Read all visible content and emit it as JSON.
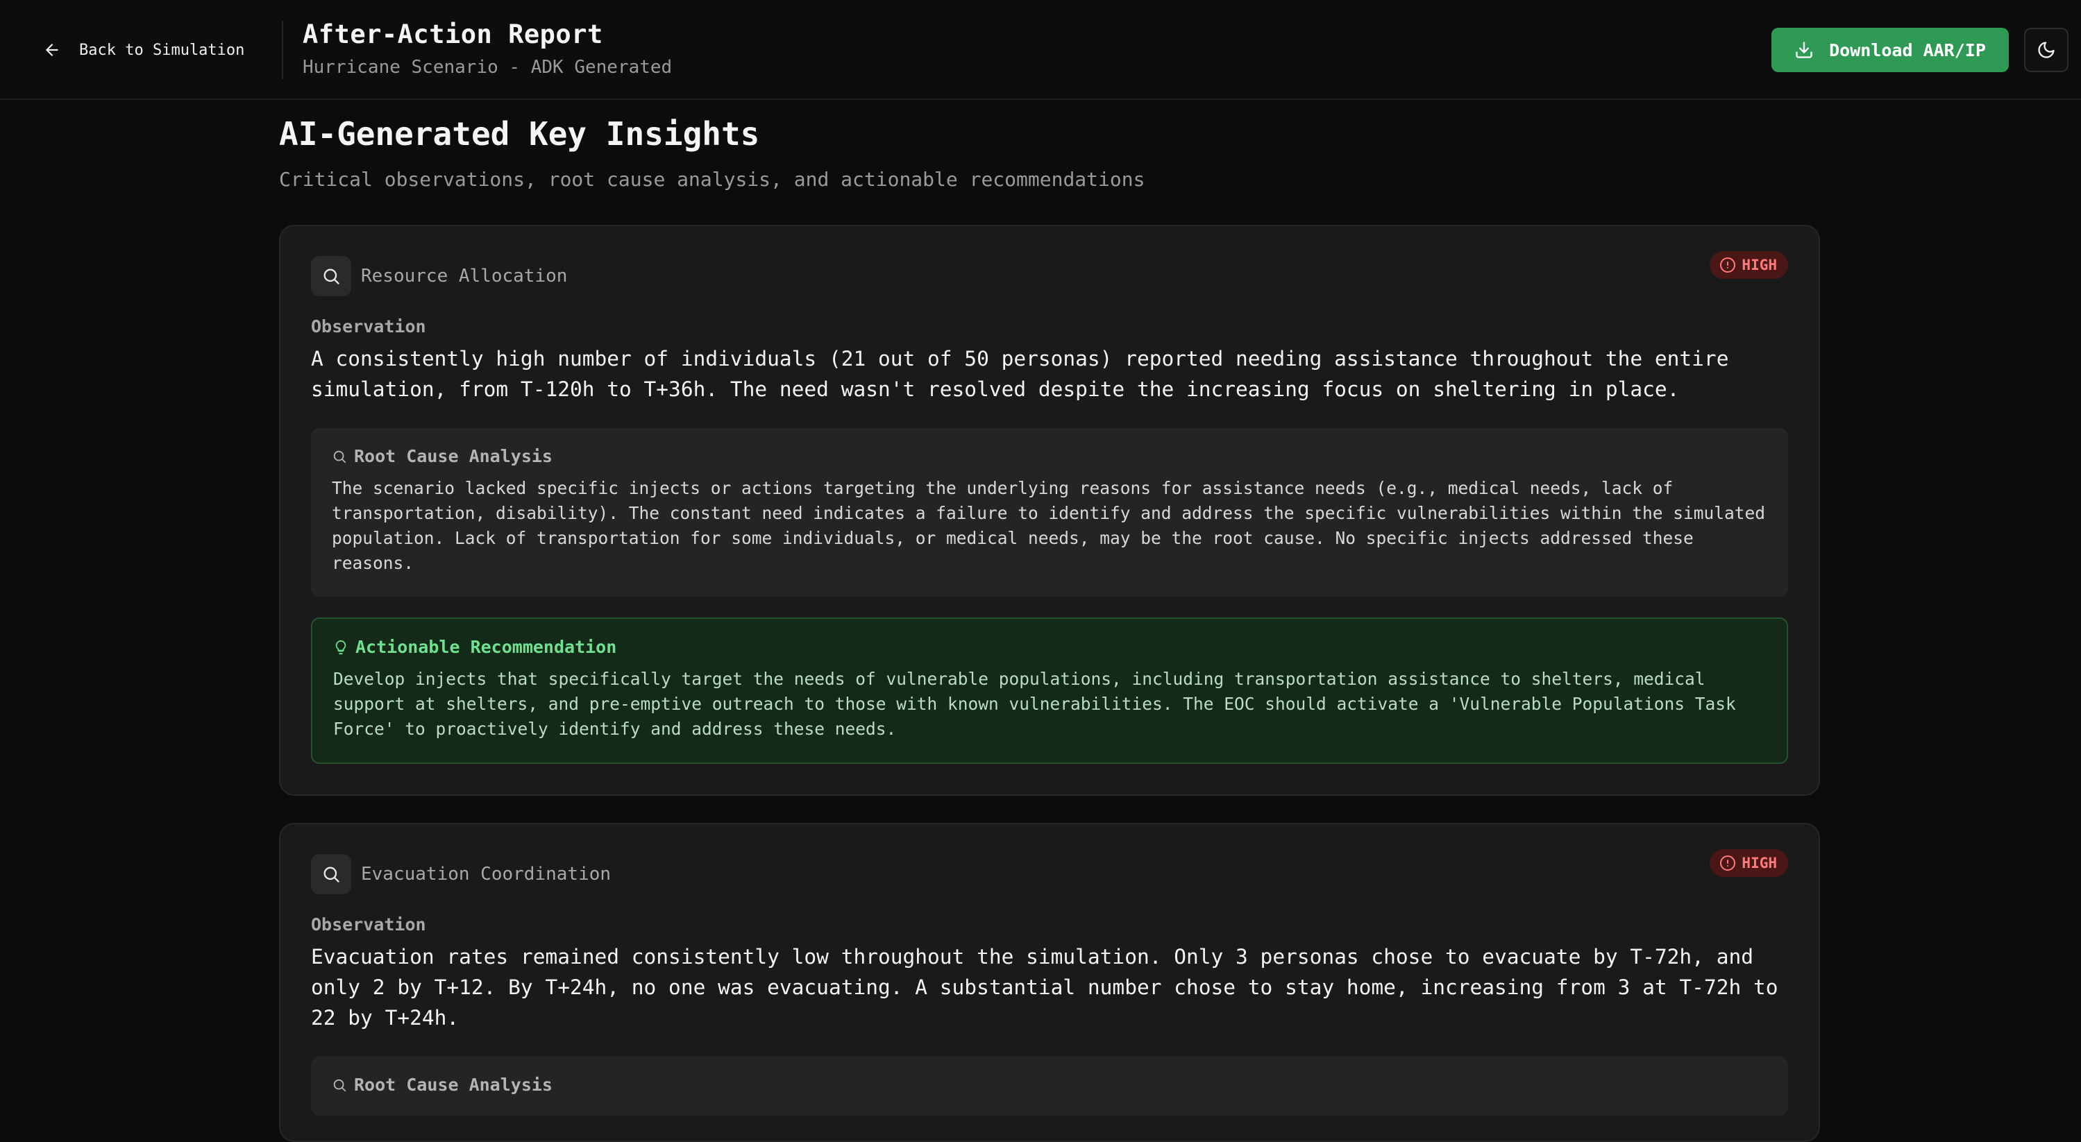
{
  "header": {
    "back_label": "Back to Simulation",
    "title": "After-Action Report",
    "subtitle": "Hurricane Scenario - ADK Generated",
    "download_label": "Download AAR/IP"
  },
  "section": {
    "title": "AI-Generated Key Insights",
    "subtitle": "Critical observations, root cause analysis, and actionable recommendations"
  },
  "labels": {
    "observation": "Observation",
    "root_cause": "Root Cause Analysis",
    "recommendation": "Actionable Recommendation"
  },
  "insights": [
    {
      "category": "Resource Allocation",
      "severity": "HIGH",
      "observation": "A consistently high number of individuals (21 out of 50 personas) reported needing assistance throughout the entire simulation, from T-120h to T+36h. The need wasn't resolved despite the increasing focus on sheltering in place.",
      "root_cause": "The scenario lacked specific injects or actions targeting the underlying reasons for assistance needs (e.g., medical needs, lack of transportation, disability). The constant need indicates a failure to identify and address the specific vulnerabilities within the simulated population. Lack of transportation for some individuals, or medical needs, may be the root cause. No specific injects addressed these reasons.",
      "recommendation": "Develop injects that specifically target the needs of vulnerable populations, including transportation assistance to shelters, medical support at shelters, and pre-emptive outreach to those with known vulnerabilities. The EOC should activate a 'Vulnerable Populations Task Force' to proactively identify and address these needs."
    },
    {
      "category": "Evacuation Coordination",
      "severity": "HIGH",
      "observation": "Evacuation rates remained consistently low throughout the simulation. Only 3 personas chose to evacuate by T-72h, and only 2 by T+12. By T+24h, no one was evacuating. A substantial number chose to stay home, increasing from 3 at T-72h to 22 by T+24h."
    }
  ],
  "colors": {
    "background": "#0c0c0c",
    "card": "#1a1a1a",
    "accent_green": "#2e9a55",
    "severity_high": "#ff7b7b",
    "recommendation_text": "#6fe08f"
  },
  "icons": {
    "back": "arrow-left-icon",
    "download": "download-icon",
    "theme": "moon-icon",
    "category": "search-icon",
    "severity": "alert-circle-icon",
    "root_cause": "search-icon",
    "recommendation": "lightbulb-icon"
  }
}
